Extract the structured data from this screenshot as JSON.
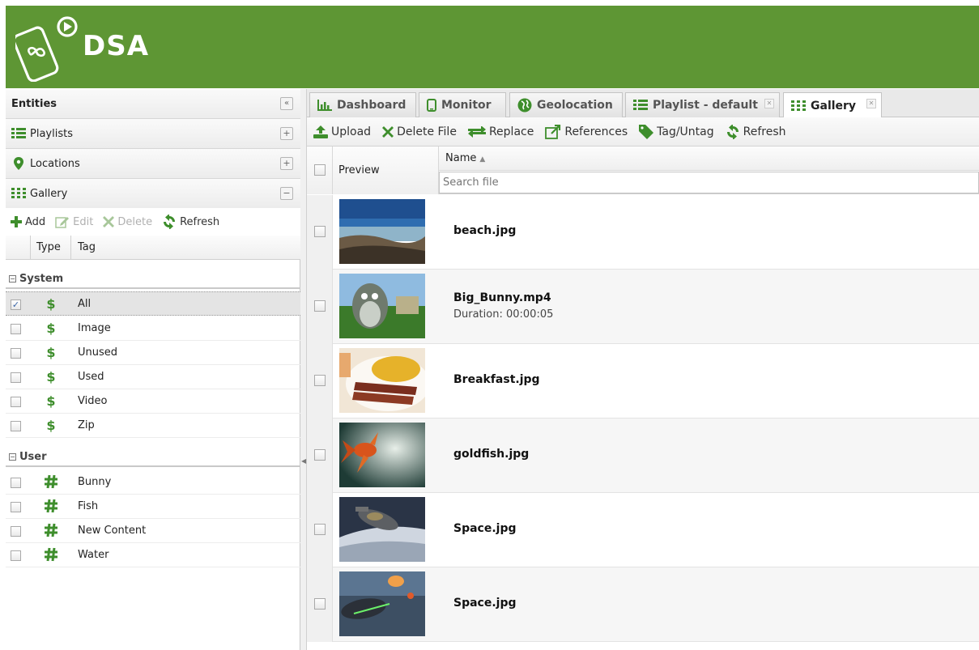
{
  "header": {
    "title": "DSA"
  },
  "left": {
    "entities_title": "Entities",
    "collapse_glyph": "«",
    "sections": [
      {
        "label": "Playlists",
        "icon": "list-icon",
        "btn": "+"
      },
      {
        "label": "Locations",
        "icon": "map-pin-icon",
        "btn": "+"
      },
      {
        "label": "Gallery",
        "icon": "grid-icon",
        "btn": "−"
      }
    ],
    "toolbar": {
      "add": "Add",
      "edit": "Edit",
      "delete": "Delete",
      "refresh": "Refresh"
    },
    "columns": {
      "type": "Type",
      "tag": "Tag"
    },
    "groups": [
      {
        "label": "System",
        "rows": [
          {
            "tag": "All",
            "checked": true,
            "icon": "dollar-icon",
            "glyph": "$"
          },
          {
            "tag": "Image",
            "checked": false,
            "icon": "dollar-icon",
            "glyph": "$"
          },
          {
            "tag": "Unused",
            "checked": false,
            "icon": "dollar-icon",
            "glyph": "$"
          },
          {
            "tag": "Used",
            "checked": false,
            "icon": "dollar-icon",
            "glyph": "$"
          },
          {
            "tag": "Video",
            "checked": false,
            "icon": "dollar-icon",
            "glyph": "$"
          },
          {
            "tag": "Zip",
            "checked": false,
            "icon": "dollar-icon",
            "glyph": "$"
          }
        ]
      },
      {
        "label": "User",
        "rows": [
          {
            "tag": "Bunny",
            "checked": false,
            "icon": "hash-tag-icon"
          },
          {
            "tag": "Fish",
            "checked": false,
            "icon": "hash-tag-icon"
          },
          {
            "tag": "New Content",
            "checked": false,
            "icon": "hash-tag-icon"
          },
          {
            "tag": "Water",
            "checked": false,
            "icon": "hash-tag-icon"
          }
        ]
      }
    ]
  },
  "tabs": [
    {
      "label": "Dashboard",
      "icon": "bar-chart-icon",
      "active": false,
      "closable": false
    },
    {
      "label": "Monitor",
      "icon": "phone-icon",
      "active": false,
      "closable": false
    },
    {
      "label": "Geolocation",
      "icon": "globe-icon",
      "active": false,
      "closable": false
    },
    {
      "label": "Playlist - default",
      "icon": "list-icon",
      "active": false,
      "closable": true
    },
    {
      "label": "Gallery",
      "icon": "grid-icon",
      "active": true,
      "closable": true
    }
  ],
  "main_toolbar": {
    "upload": "Upload",
    "delete_file": "Delete File",
    "replace": "Replace",
    "references": "References",
    "tag_untag": "Tag/Untag",
    "refresh": "Refresh"
  },
  "grid": {
    "preview_header": "Preview",
    "name_header": "Name",
    "search_placeholder": "Search file",
    "files": [
      {
        "name": "beach.jpg",
        "duration": ""
      },
      {
        "name": "Big_Bunny.mp4",
        "duration": "Duration: 00:00:05"
      },
      {
        "name": "Breakfast.jpg",
        "duration": ""
      },
      {
        "name": "goldfish.jpg",
        "duration": ""
      },
      {
        "name": "Space.jpg",
        "duration": ""
      },
      {
        "name": "Space.jpg",
        "duration": ""
      }
    ]
  },
  "colors": {
    "header_green": "#5e9634",
    "icon_green": "#3e8e2c"
  }
}
